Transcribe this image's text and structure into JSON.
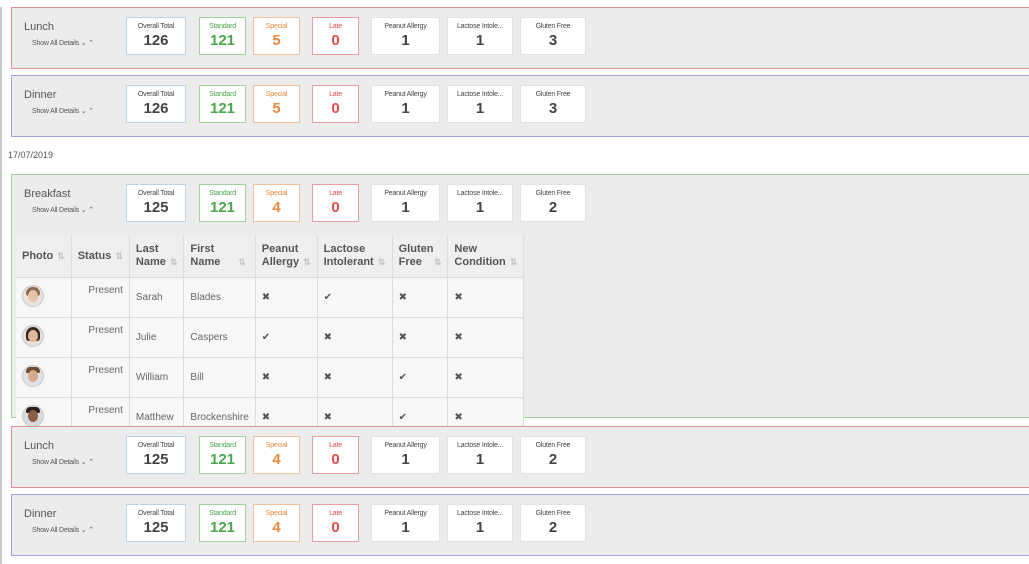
{
  "lunch_1": {
    "title": "Lunch",
    "show_details": "Show All Details ⌄ ⌃",
    "stats": {
      "overall_total": {
        "label": "Overall Total",
        "value": "126"
      },
      "standard": {
        "label": "Standard",
        "value": "121"
      },
      "special": {
        "label": "Special",
        "value": "5"
      },
      "late": {
        "label": "Late",
        "value": "0"
      },
      "peanut": {
        "label": "Peanut Allergy",
        "value": "1"
      },
      "lactose": {
        "label": "Lactose Intole...",
        "value": "1"
      },
      "gluten": {
        "label": "Gluten Free",
        "value": "3"
      }
    }
  },
  "dinner_1": {
    "title": "Dinner",
    "show_details": "Show All Details ⌄ ⌃",
    "stats": {
      "overall_total": {
        "label": "Overall Total",
        "value": "126"
      },
      "standard": {
        "label": "Standard",
        "value": "121"
      },
      "special": {
        "label": "Special",
        "value": "5"
      },
      "late": {
        "label": "Late",
        "value": "0"
      },
      "peanut": {
        "label": "Peanut Allergy",
        "value": "1"
      },
      "lactose": {
        "label": "Lactose Intole...",
        "value": "1"
      },
      "gluten": {
        "label": "Gluten Free",
        "value": "3"
      }
    }
  },
  "date_label": "17/07/2019",
  "breakfast_2": {
    "title": "Breakfast",
    "show_details": "Show All Details ⌄ ⌃",
    "stats": {
      "overall_total": {
        "label": "Overall Total",
        "value": "125"
      },
      "standard": {
        "label": "Standard",
        "value": "121"
      },
      "special": {
        "label": "Special",
        "value": "4"
      },
      "late": {
        "label": "Late",
        "value": "0"
      },
      "peanut": {
        "label": "Peanut Allergy",
        "value": "1"
      },
      "lactose": {
        "label": "Lactose Intole...",
        "value": "1"
      },
      "gluten": {
        "label": "Gluten Free",
        "value": "2"
      }
    },
    "table": {
      "headers": {
        "photo": "Photo",
        "status": "Status",
        "last_name_1": "Last",
        "last_name_2": "Name",
        "first_name_1": "First",
        "first_name_2": "Name",
        "peanut_1": "Peanut",
        "peanut_2": "Allergy",
        "lactose_1": "Lactose",
        "lactose_2": "Intolerant",
        "gluten_1": "Gluten",
        "gluten_2": "Free",
        "new_cond_1": "New",
        "new_cond_2": "Condition"
      },
      "rows": [
        {
          "status": "Present",
          "last": "Sarah",
          "first": "Blades",
          "peanut": "✖",
          "lactose": "✔",
          "gluten": "✖",
          "new": "✖"
        },
        {
          "status": "Present",
          "last": "Julie",
          "first": "Caspers",
          "peanut": "✔",
          "lactose": "✖",
          "gluten": "✖",
          "new": "✖"
        },
        {
          "status": "Present",
          "last": "William",
          "first": "Bill",
          "peanut": "✖",
          "lactose": "✖",
          "gluten": "✔",
          "new": "✖"
        },
        {
          "status": "Present",
          "last": "Matthew",
          "first": "Brockenshire",
          "peanut": "✖",
          "lactose": "✖",
          "gluten": "✔",
          "new": "✖"
        }
      ]
    }
  },
  "lunch_2": {
    "title": "Lunch",
    "show_details": "Show All Details ⌄ ⌃",
    "stats": {
      "overall_total": {
        "label": "Overall Total",
        "value": "125"
      },
      "standard": {
        "label": "Standard",
        "value": "121"
      },
      "special": {
        "label": "Special",
        "value": "4"
      },
      "late": {
        "label": "Late",
        "value": "0"
      },
      "peanut": {
        "label": "Peanut Allergy",
        "value": "1"
      },
      "lactose": {
        "label": "Lactose Intole...",
        "value": "1"
      },
      "gluten": {
        "label": "Gluten Free",
        "value": "2"
      }
    }
  },
  "dinner_2": {
    "title": "Dinner",
    "show_details": "Show All Details ⌄ ⌃",
    "stats": {
      "overall_total": {
        "label": "Overall Total",
        "value": "125"
      },
      "standard": {
        "label": "Standard",
        "value": "121"
      },
      "special": {
        "label": "Special",
        "value": "4"
      },
      "late": {
        "label": "Late",
        "value": "0"
      },
      "peanut": {
        "label": "Peanut Allergy",
        "value": "1"
      },
      "lactose": {
        "label": "Lactose Intole...",
        "value": "1"
      },
      "gluten": {
        "label": "Gluten Free",
        "value": "2"
      }
    }
  },
  "icons": {
    "sort": "sort-icon",
    "check": "check-icon",
    "cross": "cross-icon",
    "avatar": "avatar-photo"
  },
  "colors": {
    "lunch_border": "#e38f94",
    "dinner_border": "#9da3df",
    "breakfast_border": "#9fd39a",
    "standard": "#4aa64a",
    "special": "#ea8a3c",
    "late": "#e34c4c"
  }
}
